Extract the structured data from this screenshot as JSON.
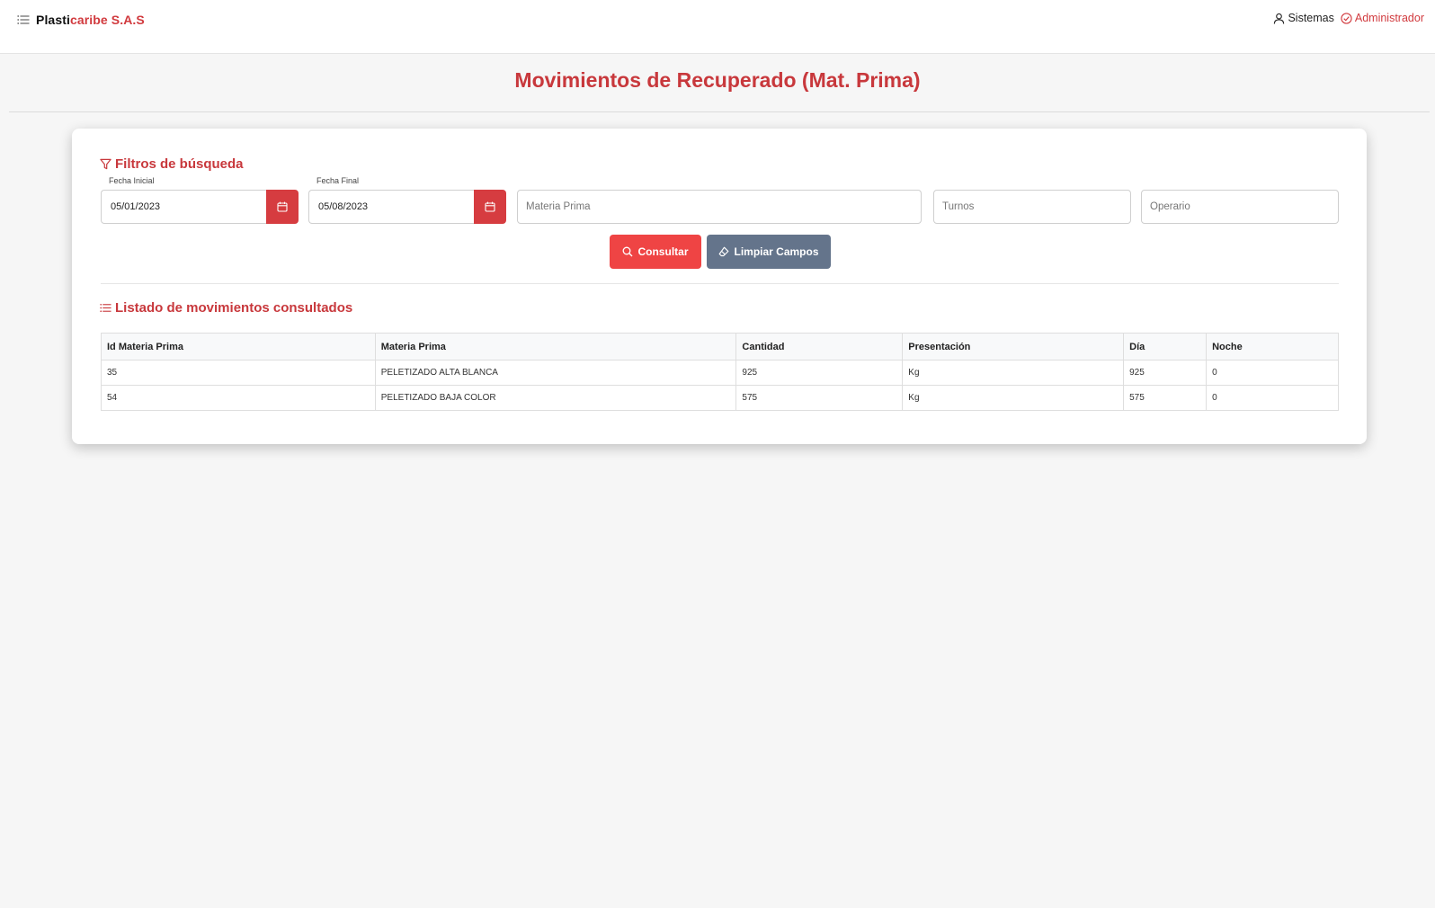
{
  "app": {
    "brand_part1": "Plasti",
    "brand_part2": "caribe S.A.S",
    "user_name": "Sistemas",
    "user_role": "Administrador",
    "accent_color": "#d13a3e"
  },
  "page": {
    "title": "Movimientos de Recuperado (Mat. Prima)"
  },
  "filters": {
    "heading": "Filtros de búsqueda",
    "fecha_inicial_label": "Fecha Inicial",
    "fecha_inicial_value": "05/01/2023",
    "fecha_final_label": "Fecha Final",
    "fecha_final_value": "05/08/2023",
    "materia_prima_placeholder": "Materia Prima",
    "turnos_placeholder": "Turnos",
    "operario_placeholder": "Operario",
    "consultar_label": "Consultar",
    "limpiar_label": "Limpiar Campos"
  },
  "list": {
    "heading": "Listado de movimientos consultados",
    "columns": [
      "Id Materia Prima",
      "Materia Prima",
      "Cantidad",
      "Presentación",
      "Día",
      "Noche"
    ],
    "rows": [
      [
        "35",
        "PELETIZADO ALTA BLANCA",
        "925",
        "Kg",
        "925",
        "0"
      ],
      [
        "54",
        "PELETIZADO BAJA COLOR",
        "575",
        "Kg",
        "575",
        "0"
      ]
    ]
  }
}
